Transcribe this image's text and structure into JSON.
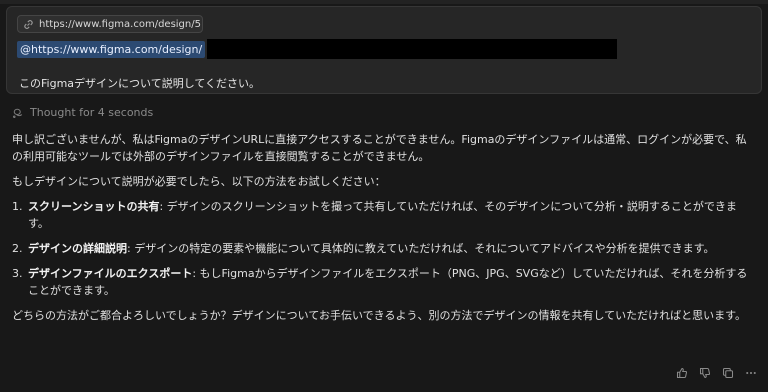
{
  "prompt": {
    "link_chip": "https://www.figma.com/design/5...",
    "mention": "@https://www.figma.com/design/",
    "question": "このFigmaデザインについて説明してください。"
  },
  "thought": {
    "label": "Thought for 4 seconds"
  },
  "response": {
    "intro": "申し訳ございませんが、私はFigmaのデザインURLに直接アクセスすることができません。Figmaのデザインファイルは通常、ログインが必要で、私の利用可能なツールでは外部のデザインファイルを直接閲覧することができません。",
    "lead": "もしデザインについて説明が必要でしたら、以下の方法をお試しください：",
    "options": [
      {
        "title": "スクリーンショットの共有",
        "text": ": デザインのスクリーンショットを撮って共有していただければ、そのデザインについて分析・説明することができます。"
      },
      {
        "title": "デザインの詳細説明",
        "text": ": デザインの特定の要素や機能について具体的に教えていただければ、それについてアドバイスや分析を提供できます。"
      },
      {
        "title": "デザインファイルのエクスポート",
        "text": ": もしFigmaからデザインファイルをエクスポート（PNG、JPG、SVGなど）していただければ、それを分析することができます。"
      }
    ],
    "closing": "どちらの方法がご都合よろしいでしょうか？デザインについてお手伝いできるよう、別の方法でデザインの情報を共有していただければと思います。"
  },
  "actions": {
    "icons": [
      "thumbs-up-icon",
      "thumbs-down-icon",
      "copy-icon",
      "more-icon"
    ]
  }
}
